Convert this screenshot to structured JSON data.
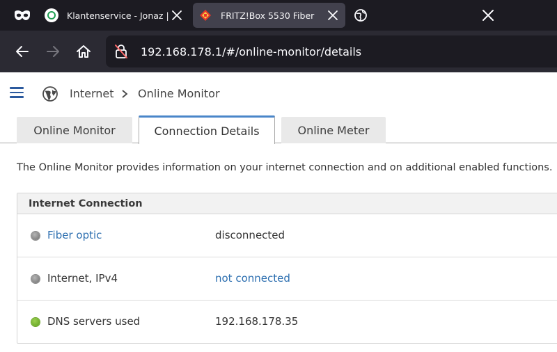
{
  "browser": {
    "tabs": [
      {
        "title": "Klantenservice - Jonaz | Int",
        "active": false
      },
      {
        "title": "FRITZ!Box 5530 Fiber",
        "active": true
      }
    ],
    "url": "192.168.178.1/#/online-monitor/details",
    "icons": [
      "private-mask-icon",
      "globe-icon",
      "back-arrow-icon",
      "forward-arrow-icon",
      "home-icon",
      "insecure-lock-icon",
      "close-icon"
    ]
  },
  "page": {
    "breadcrumb": {
      "section": "Internet",
      "page": "Online Monitor"
    },
    "tabs": [
      {
        "label": "Online Monitor",
        "active": false
      },
      {
        "label": "Connection Details",
        "active": true
      },
      {
        "label": "Online Meter",
        "active": false
      }
    ],
    "description": "The Online Monitor provides information on your internet connection and on additional enabled functions.",
    "panel": {
      "title": "Internet Connection",
      "rows": [
        {
          "label": "Fiber optic",
          "value": "disconnected",
          "status": "grey"
        },
        {
          "label": "Internet, IPv4",
          "value": "not connected",
          "status": "grey"
        },
        {
          "label": "DNS servers used",
          "value": "192.168.178.35",
          "status": "green"
        }
      ]
    }
  },
  "colors": {
    "accent": "#2d6fb0",
    "active_tab_border": "#4a86c9",
    "status_green": "#6aa525",
    "status_grey": "#8a8a8a"
  }
}
